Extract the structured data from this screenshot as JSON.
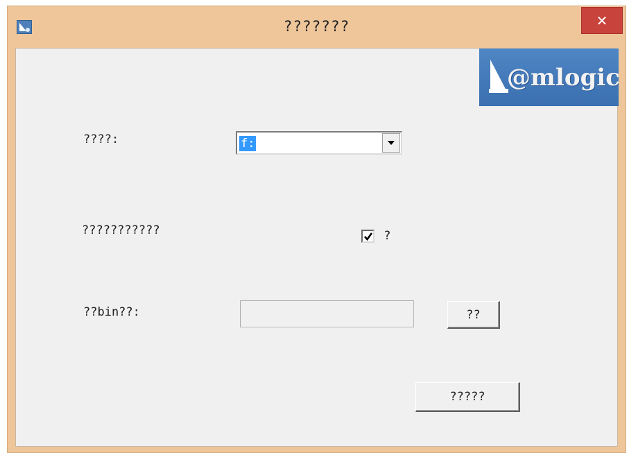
{
  "window": {
    "title": "???????",
    "close_glyph": "✕",
    "title_bar_color": "#eec69a",
    "close_color": "#c9433d"
  },
  "logo": {
    "text": "@mlogic"
  },
  "form": {
    "drive_label": "????:",
    "drive_value": "f:",
    "option_label": "???????????",
    "option_checkbox_label": "?",
    "option_checked": true,
    "bin_label": "??bin??:",
    "bin_path_value": "",
    "browse_label": "??",
    "ok_label": "?????"
  },
  "icons": {
    "app": "amlogic-app-icon",
    "dropdown": "chevron-down-icon",
    "check": "check-icon",
    "close": "close-icon"
  }
}
